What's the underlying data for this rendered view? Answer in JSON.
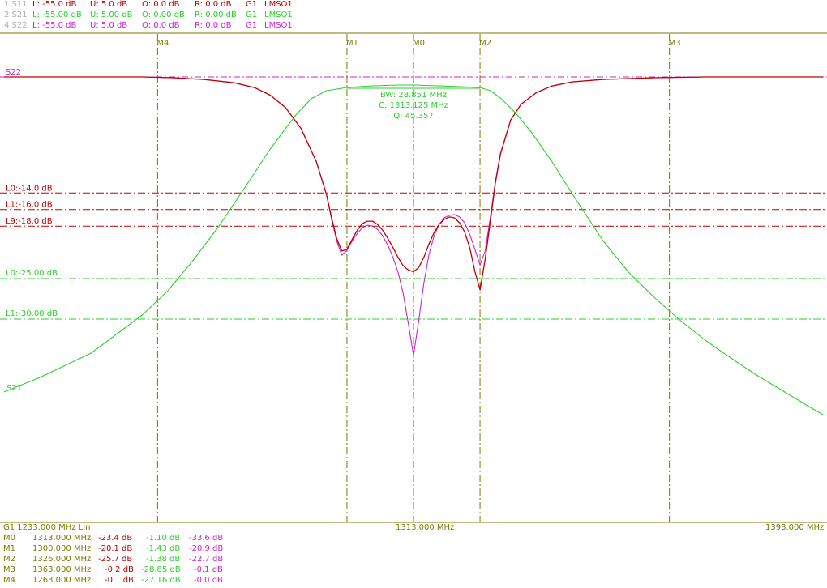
{
  "colors": {
    "s11": "#c00000",
    "s21": "#2ad12a",
    "s22": "#cc22cc",
    "marker": "#7a7a00",
    "muted": "#b0b0b0"
  },
  "header_rows": [
    {
      "id": "1 S11",
      "l": "L: -55.0 dB",
      "u": "U: 5.0 dB",
      "o": "O: 0.0 dB",
      "r": "R: 0.0 dB",
      "g": "G1",
      "m": "LMSO1",
      "color": "#c00000"
    },
    {
      "id": "2 S21",
      "l": "L: -55.00 dB",
      "u": "U: 5.00 dB",
      "o": "O: 0.00 dB",
      "r": "R: 0.00 dB",
      "g": "G1",
      "m": "LMSO1",
      "color": "#2ad12a"
    },
    {
      "id": "4 S22",
      "l": "L: -55.0 dB",
      "u": "U: 5.0 dB",
      "o": "O: 0.0 dB",
      "r": "R: 0.0 dB",
      "g": "G1",
      "m": "LMSO1",
      "color": "#cc22cc"
    }
  ],
  "limits": {
    "s11": [
      {
        "label": "L0:-14.0 dB",
        "value": -14
      },
      {
        "label": "L1:-16.0 dB",
        "value": -16
      },
      {
        "label": "L9:-18.0 dB",
        "value": -18
      }
    ],
    "s21": [
      {
        "label": "L0:-25.00 dB",
        "value": -25
      },
      {
        "label": "L1:-30.00 dB",
        "value": -30
      }
    ]
  },
  "bw_box": {
    "bw": "BW: 28.851 MHz",
    "c": "C: 1313.125 MHz",
    "q": "Q: 45.357"
  },
  "trace_labels": {
    "top": "S22",
    "s21": "S21"
  },
  "axis": {
    "start": "G1   1233.000 MHz Lin",
    "center": "1313.000 MHz",
    "stop": "1393.000 MHz"
  },
  "marker_table": [
    {
      "name": "M0",
      "freq": "1313.000 MHz",
      "s11": "-23.4 dB",
      "s21": "-1.10 dB",
      "s22": "-33.6 dB"
    },
    {
      "name": "M1",
      "freq": "1300.000 MHz",
      "s11": "-20.1 dB",
      "s21": "-1.43 dB",
      "s22": "-20.9 dB"
    },
    {
      "name": "M2",
      "freq": "1326.000 MHz",
      "s11": "-25.7 dB",
      "s21": "-1.38 dB",
      "s22": "-22.7 dB"
    },
    {
      "name": "M3",
      "freq": "1363.000 MHz",
      "s11": "-0.2 dB",
      "s21": "-28.85 dB",
      "s22": "-0.1 dB"
    },
    {
      "name": "M4",
      "freq": "1263.000 MHz",
      "s11": "-0.1 dB",
      "s21": "-27.16 dB",
      "s22": "-0.0 dB"
    }
  ],
  "chart_data": {
    "type": "line",
    "xlim": [
      1233,
      1393
    ],
    "ylim_s11": [
      -55,
      5
    ],
    "ylim_s21": [
      -55,
      5
    ],
    "markers": [
      {
        "name": "M4",
        "x": 1263
      },
      {
        "name": "M1",
        "x": 1300
      },
      {
        "name": "M0",
        "x": 1313
      },
      {
        "name": "M2",
        "x": 1326
      },
      {
        "name": "M3",
        "x": 1363
      }
    ],
    "series": [
      {
        "name": "S11",
        "axis": "s11",
        "x": [
          1233,
          1250,
          1260,
          1266,
          1272,
          1278,
          1282,
          1285,
          1288,
          1291,
          1294,
          1296,
          1297,
          1298,
          1299,
          1300,
          1301,
          1302,
          1303,
          1304,
          1305,
          1306,
          1307,
          1308,
          1309,
          1310,
          1311,
          1312,
          1313,
          1314,
          1315,
          1316,
          1317,
          1318,
          1319,
          1320,
          1321,
          1322,
          1323,
          1324,
          1325,
          1326,
          1327,
          1328,
          1329,
          1330,
          1332,
          1334,
          1337,
          1340,
          1344,
          1350,
          1360,
          1370,
          1380,
          1393
        ],
        "y": [
          0,
          0,
          0,
          -0.1,
          -0.3,
          -0.7,
          -1.3,
          -2.2,
          -3.7,
          -6.2,
          -10.2,
          -14.2,
          -17,
          -19.5,
          -21,
          -20.8,
          -19.6,
          -18.5,
          -17.7,
          -17.4,
          -17.4,
          -17.8,
          -18.5,
          -19.5,
          -20.6,
          -21.8,
          -22.8,
          -23.3,
          -23.5,
          -23,
          -21.8,
          -20.2,
          -18.8,
          -17.8,
          -17.2,
          -16.9,
          -17.0,
          -17.6,
          -18.7,
          -20.6,
          -23.5,
          -25.7,
          -22,
          -17.5,
          -12.8,
          -9.3,
          -5.2,
          -3.3,
          -1.9,
          -1.1,
          -0.6,
          -0.3,
          -0.1,
          0,
          0,
          0
        ]
      },
      {
        "name": "S21",
        "axis": "s21",
        "x": [
          1233,
          1240,
          1250,
          1260,
          1265,
          1270,
          1275,
          1280,
          1285,
          1290,
          1293,
          1296,
          1300,
          1305,
          1310,
          1313,
          1318,
          1322,
          1326,
          1328,
          1330,
          1333,
          1336,
          1340,
          1345,
          1350,
          1355,
          1360,
          1365,
          1370,
          1375,
          1380,
          1385,
          1390,
          1393
        ],
        "y": [
          -39,
          -37.2,
          -34.2,
          -29.5,
          -26.5,
          -22.7,
          -18.5,
          -13.8,
          -9.0,
          -4.8,
          -2.8,
          -1.8,
          -1.4,
          -1.2,
          -1.1,
          -1.1,
          -1.2,
          -1.3,
          -1.4,
          -1.8,
          -2.7,
          -4.6,
          -6.9,
          -10.5,
          -15.5,
          -20.3,
          -24.2,
          -27.3,
          -30.1,
          -32.6,
          -34.8,
          -36.9,
          -38.8,
          -40.7,
          -41.8
        ]
      },
      {
        "name": "S22",
        "axis": "s11",
        "x": [
          1233,
          1250,
          1260,
          1266,
          1272,
          1278,
          1282,
          1285,
          1288,
          1291,
          1294,
          1296,
          1297,
          1298,
          1299,
          1300,
          1301,
          1302,
          1303,
          1304,
          1305,
          1306,
          1307,
          1308,
          1309,
          1310,
          1311,
          1312,
          1313,
          1314,
          1315,
          1316,
          1317,
          1318,
          1319,
          1320,
          1321,
          1322,
          1323,
          1324,
          1325,
          1326,
          1327,
          1328,
          1329,
          1330,
          1332,
          1334,
          1337,
          1340,
          1344,
          1350,
          1360,
          1370,
          1380,
          1393
        ],
        "y": [
          0,
          0,
          0,
          -0.1,
          -0.3,
          -0.7,
          -1.3,
          -2.2,
          -3.7,
          -6.2,
          -10.2,
          -14.2,
          -17.2,
          -19.8,
          -21.5,
          -20.9,
          -19.8,
          -18.9,
          -18.2,
          -17.9,
          -18.0,
          -18.4,
          -19.2,
          -20.3,
          -21.8,
          -23.6,
          -26.2,
          -29.8,
          -33.6,
          -29.5,
          -25,
          -21.5,
          -19.2,
          -17.8,
          -17.0,
          -16.7,
          -16.6,
          -16.9,
          -17.6,
          -19.0,
          -20.8,
          -22.7,
          -21,
          -17,
          -12.6,
          -9.2,
          -5.2,
          -3.3,
          -1.9,
          -1.1,
          -0.6,
          -0.3,
          -0.1,
          0,
          0,
          0
        ]
      }
    ]
  }
}
